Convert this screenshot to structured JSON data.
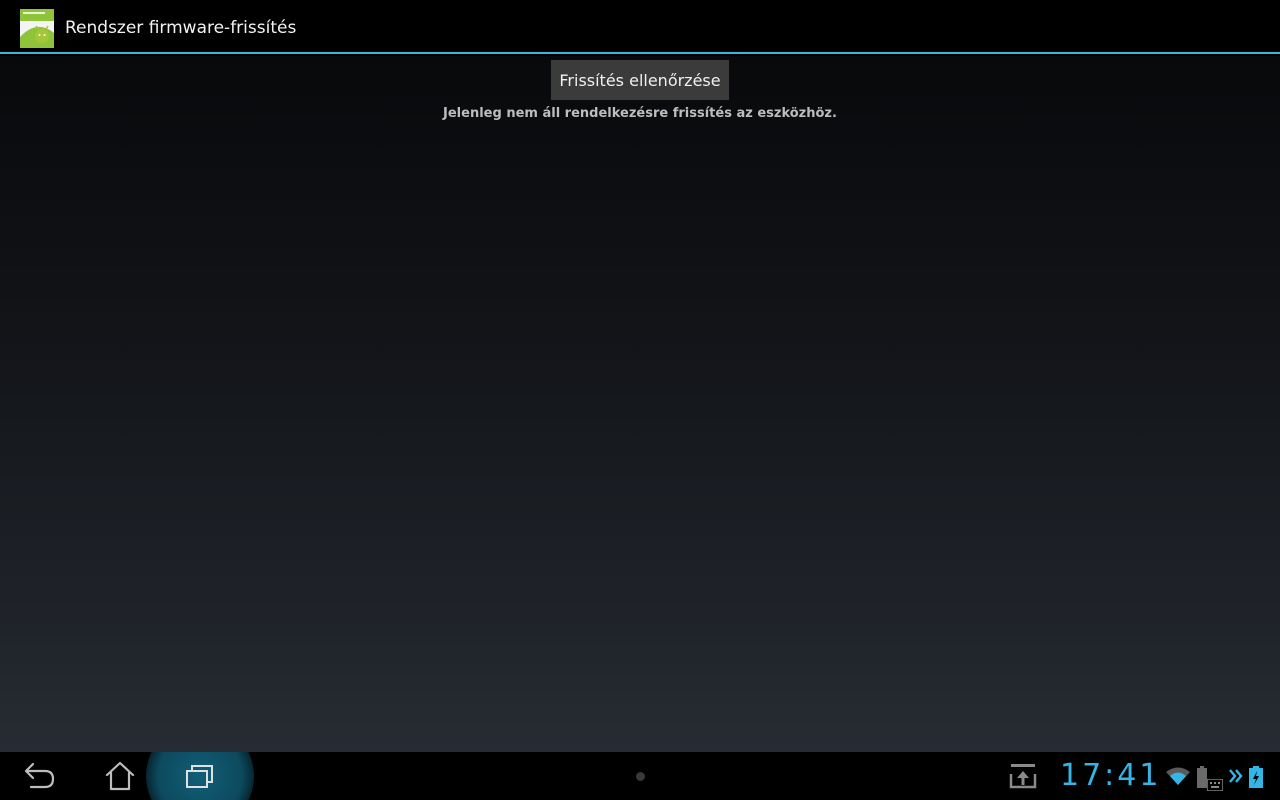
{
  "action_bar": {
    "title": "Rendszer firmware-frissítés",
    "app_icon": "android-update-icon",
    "accent_color": "#33b5e5"
  },
  "main": {
    "check_button_label": "Frissítés ellenőrzése",
    "status_text": "Jelenleg nem áll rendelkezésre frissítés az eszközhöz."
  },
  "system_bar": {
    "nav": [
      "back-icon",
      "home-icon",
      "recent-apps-icon"
    ],
    "active_nav": "recent-apps-icon",
    "clock": "17:41",
    "status_icons": [
      "download-icon",
      "wifi-icon",
      "battery-dock-icon",
      "keyboard-icon",
      "chevrons-icon",
      "battery-charging-icon"
    ]
  }
}
